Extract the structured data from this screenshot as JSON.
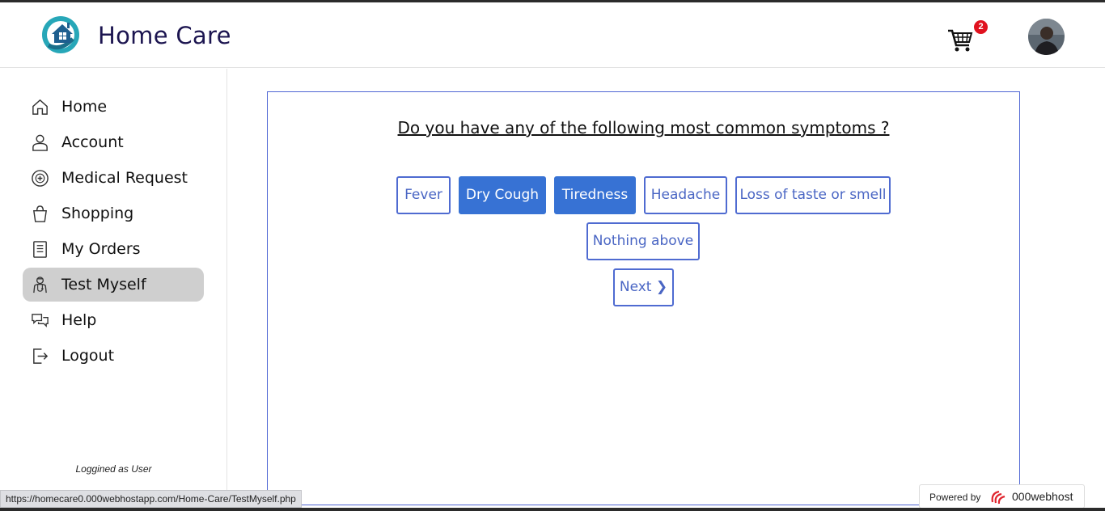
{
  "header": {
    "brand": "Home Care",
    "cart_count": "2",
    "icons": [
      "home-care-logo",
      "cart-icon",
      "avatar"
    ]
  },
  "sidebar": {
    "items": [
      {
        "label": "Home",
        "icon": "home-icon"
      },
      {
        "label": "Account",
        "icon": "user-icon"
      },
      {
        "label": "Medical Request",
        "icon": "medical-icon"
      },
      {
        "label": "Shopping",
        "icon": "bag-icon"
      },
      {
        "label": "My Orders",
        "icon": "orders-icon"
      },
      {
        "label": "Test Myself",
        "icon": "doctor-icon",
        "active": true
      },
      {
        "label": "Help",
        "icon": "chat-icon"
      },
      {
        "label": "Logout",
        "icon": "logout-icon"
      }
    ],
    "logged_text": "Loggined as User"
  },
  "main": {
    "question": "Do you have any of the following most common symptoms ?",
    "options": [
      {
        "label": "Fever",
        "selected": false
      },
      {
        "label": "Dry Cough",
        "selected": true
      },
      {
        "label": "Tiredness",
        "selected": true
      },
      {
        "label": "Headache",
        "selected": false
      },
      {
        "label": "Loss of taste or smell",
        "selected": false
      },
      {
        "label": "Nothing above",
        "selected": false
      }
    ],
    "next_label": "Next ❯"
  },
  "status_bar": {
    "url": "https://homecare0.000webhostapp.com/Home-Care/TestMyself.php"
  },
  "powered": {
    "prefix": "Powered by",
    "brand": "000webhost"
  },
  "colors": {
    "accent": "#3772d4",
    "border": "#4f6bd1",
    "brand_text": "#1c1550",
    "badge": "#e0121f"
  }
}
